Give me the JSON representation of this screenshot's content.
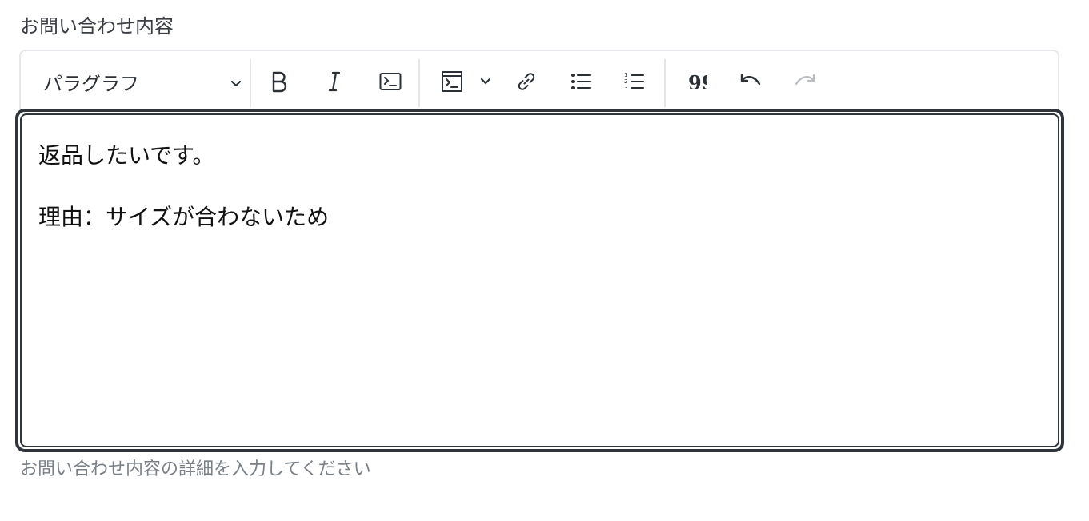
{
  "form": {
    "label": "お問い合わせ内容",
    "help_text": "お問い合わせ内容の詳細を入力してください"
  },
  "toolbar": {
    "paragraph_select": {
      "selected": "パラグラフ",
      "icon": "chevron-down-icon"
    },
    "buttons": [
      {
        "name": "bold",
        "icon": "bold-icon",
        "label": "B"
      },
      {
        "name": "italic",
        "icon": "italic-icon",
        "label": "I"
      },
      {
        "name": "code",
        "icon": "code-icon"
      },
      {
        "name": "code-block",
        "icon": "code-block-icon"
      },
      {
        "name": "code-block-dropdown",
        "icon": "chevron-down-icon"
      },
      {
        "name": "link",
        "icon": "link-icon"
      },
      {
        "name": "bulleted-list",
        "icon": "bulleted-list-icon"
      },
      {
        "name": "numbered-list",
        "icon": "numbered-list-icon"
      },
      {
        "name": "block-quote",
        "icon": "quote-icon"
      },
      {
        "name": "undo",
        "icon": "undo-icon"
      },
      {
        "name": "redo",
        "icon": "redo-icon",
        "disabled": true
      }
    ]
  },
  "editor": {
    "paragraphs": [
      "返品したいです。",
      "理由：サイズが合わないため"
    ]
  },
  "colors": {
    "editor_border": "#2f353b",
    "toolbar_border": "#e6e8eb",
    "help_text": "#7a8087",
    "disabled_icon": "#b9bdc2"
  }
}
